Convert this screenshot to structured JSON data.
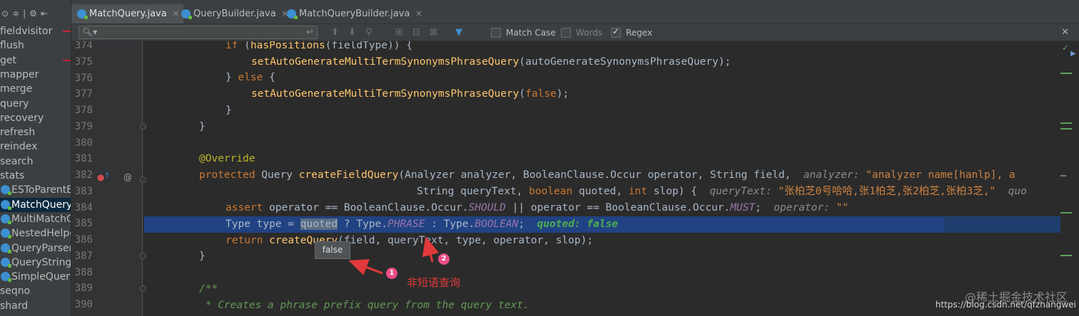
{
  "sidebar": {
    "items": [
      {
        "label": "fieldvisitor",
        "kind": "folder",
        "error": true
      },
      {
        "label": "flush",
        "kind": "folder"
      },
      {
        "label": "get",
        "kind": "folder",
        "error": true
      },
      {
        "label": "mapper",
        "kind": "folder"
      },
      {
        "label": "merge",
        "kind": "folder"
      },
      {
        "label": "query",
        "kind": "folder"
      },
      {
        "label": "recovery",
        "kind": "folder"
      },
      {
        "label": "refresh",
        "kind": "folder"
      },
      {
        "label": "reindex",
        "kind": "folder"
      },
      {
        "label": "search",
        "kind": "folder"
      },
      {
        "label": "stats",
        "kind": "folder"
      },
      {
        "label": "ESToParentB",
        "kind": "class"
      },
      {
        "label": "MatchQuery",
        "kind": "class",
        "selected": true
      },
      {
        "label": "MultiMatchQ",
        "kind": "class"
      },
      {
        "label": "NestedHelpe",
        "kind": "class"
      },
      {
        "label": "QueryParserI",
        "kind": "class"
      },
      {
        "label": "QueryStringC",
        "kind": "class"
      },
      {
        "label": "SimpleQuery",
        "kind": "class"
      },
      {
        "label": "seqno",
        "kind": "folder"
      },
      {
        "label": "shard",
        "kind": "folder"
      }
    ]
  },
  "tabs": [
    {
      "label": "MatchQuery.java",
      "active": true
    },
    {
      "label": "QueryBuilder.java",
      "active": false
    },
    {
      "label": "MatchQueryBuilder.java",
      "active": false
    }
  ],
  "findbar": {
    "match_case": "Match Case",
    "words": "Words",
    "regex": "Regex"
  },
  "editor": {
    "line_numbers": [
      "374",
      "375",
      "376",
      "377",
      "378",
      "379",
      "380",
      "381",
      "382",
      "383",
      "384",
      "385",
      "386",
      "387",
      "388",
      "389",
      "390"
    ],
    "l374": {
      "kw": "if",
      "a": " (",
      "fn": "hasPositions",
      "b": "(fieldType)) {"
    },
    "l375": {
      "fn": "setAutoGenerateMultiTermSynonymsPhraseQuery",
      "b": "(autoGenerateSynonymsPhraseQuery);"
    },
    "l376": {
      "a": "} ",
      "kw": "else",
      "b": " {"
    },
    "l377": {
      "fn": "setAutoGenerateMultiTermSynonymsPhraseQuery",
      "a": "(",
      "kw": "false",
      "b": ");"
    },
    "l378": {
      "a": "}"
    },
    "l379": {
      "a": "}"
    },
    "l381": {
      "ann": "@Override"
    },
    "l382": {
      "kw": "protected",
      "a": " Query ",
      "fn": "createFieldQuery",
      "b": "(Analyzer analyzer, BooleanClause.Occur operator, String field,",
      "hint_label": "analyzer:",
      "hint_val": "\"analyzer name[hanlp], a"
    },
    "l383": {
      "a": "String queryText, ",
      "kw1": "boolean",
      "b": " quoted, ",
      "kw2": "int",
      "c": " slop) {",
      "hint_label": "queryText:",
      "hint_val": "\"张柏芝0号哈哈,张1柏芝,张2柏芝,张柏3芝,\"",
      "hint_tail": "quo"
    },
    "l384": {
      "kw": "assert",
      "a": " operator == BooleanClause.Occur.",
      "f1": "SHOULD",
      "b": " || operator == BooleanClause.Occur.",
      "f2": "MUST",
      "c": ";",
      "hint_label": "operator:",
      "hint_val": "\"\""
    },
    "l385": {
      "a": "Type type = ",
      "sel": "quoted",
      "b": " ? Type.",
      "f1": "PHRASE",
      "c": " : Type.",
      "f2": "BOOLEAN",
      "d": ";",
      "debug": "quoted: false"
    },
    "l386": {
      "kw": "return",
      "a": " ",
      "fn": "createQuery",
      "b": "(field, queryText, type, operator, slop);"
    },
    "l387": {
      "a": "}"
    },
    "l389": {
      "cmt": "/**"
    },
    "l390": {
      "cmt": " * Creates a phrase prefix query from the query text."
    }
  },
  "tooltip": {
    "text": "false"
  },
  "annotations": {
    "badge1": "1",
    "badge2": "2",
    "caption": "非短语查询"
  },
  "watermark": {
    "site": "@稀土掘金技术社区",
    "url": "https://blog.csdn.net/qfzhangwei"
  },
  "colors": {
    "keyword": "#cc7832",
    "method": "#ffc66d",
    "field": "#9876aa",
    "annotation": "#bbb529",
    "arrow": "#e23a3a",
    "selection": "#214283"
  }
}
